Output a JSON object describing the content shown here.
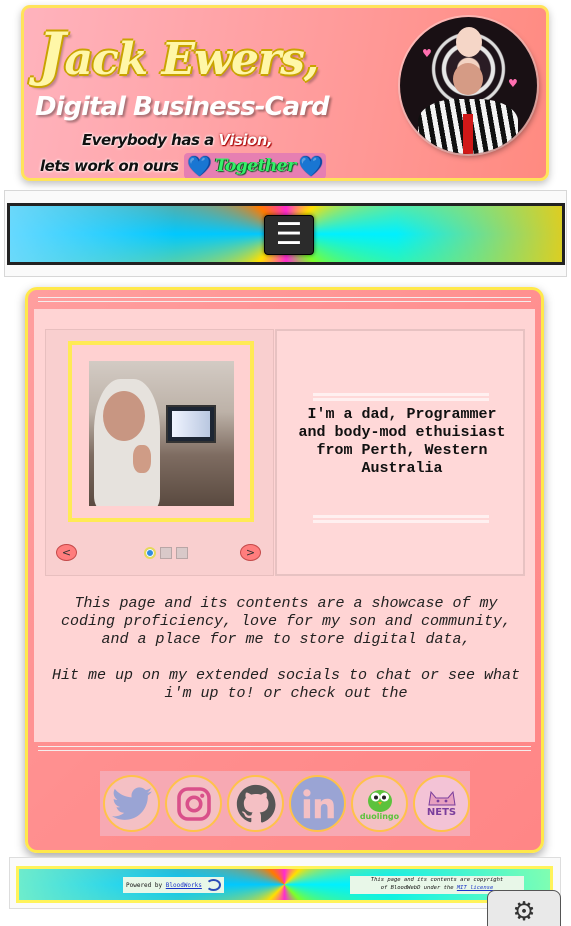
{
  "header": {
    "name_initial": "J",
    "name_rest": "ack Ewers,",
    "card_title": "Digital Business-Card",
    "tagline_line1_a": "Everybody has a ",
    "tagline_line1_highlight": "Vision,",
    "tagline_line2": "lets work on ours",
    "heart_glyph": "💙",
    "together": "Together"
  },
  "nav": {
    "menu_glyph": "☰"
  },
  "carousel": {
    "prev": "<",
    "next": ">",
    "slide_count": 3,
    "active_slide": 1
  },
  "bio": {
    "text": "I'm a dad, Programmer and body-mod ethuisiast from Perth, Western Australia"
  },
  "about": {
    "paragraph1": "This page and its contents are a showcase of my coding proficiency, love for my son and community, and a place for me to store digital data,",
    "paragraph2": "Hit me up on my extended socials to chat or see what i'm up to! or check out the"
  },
  "socials": {
    "items": [
      "twitter",
      "instagram",
      "github",
      "linkedin",
      "duolingo",
      "nets"
    ],
    "duolingo_label": "duolingo",
    "nets_label": "NETS"
  },
  "footer": {
    "powered_by": "Powered by ",
    "powered_link": "BloodWorks",
    "copyright_line1": "This page and its contents are copyright",
    "copyright_line2a": "of BloodWebD under the ",
    "copyright_link": "MIT license"
  },
  "settings": {
    "gear_glyph": "⚙"
  },
  "colors": {
    "accent_yellow": "#ffe84a",
    "card_pink": "#ff9e9e",
    "heart_blue": "#1b8fe6",
    "together_green": "#36f06a"
  }
}
